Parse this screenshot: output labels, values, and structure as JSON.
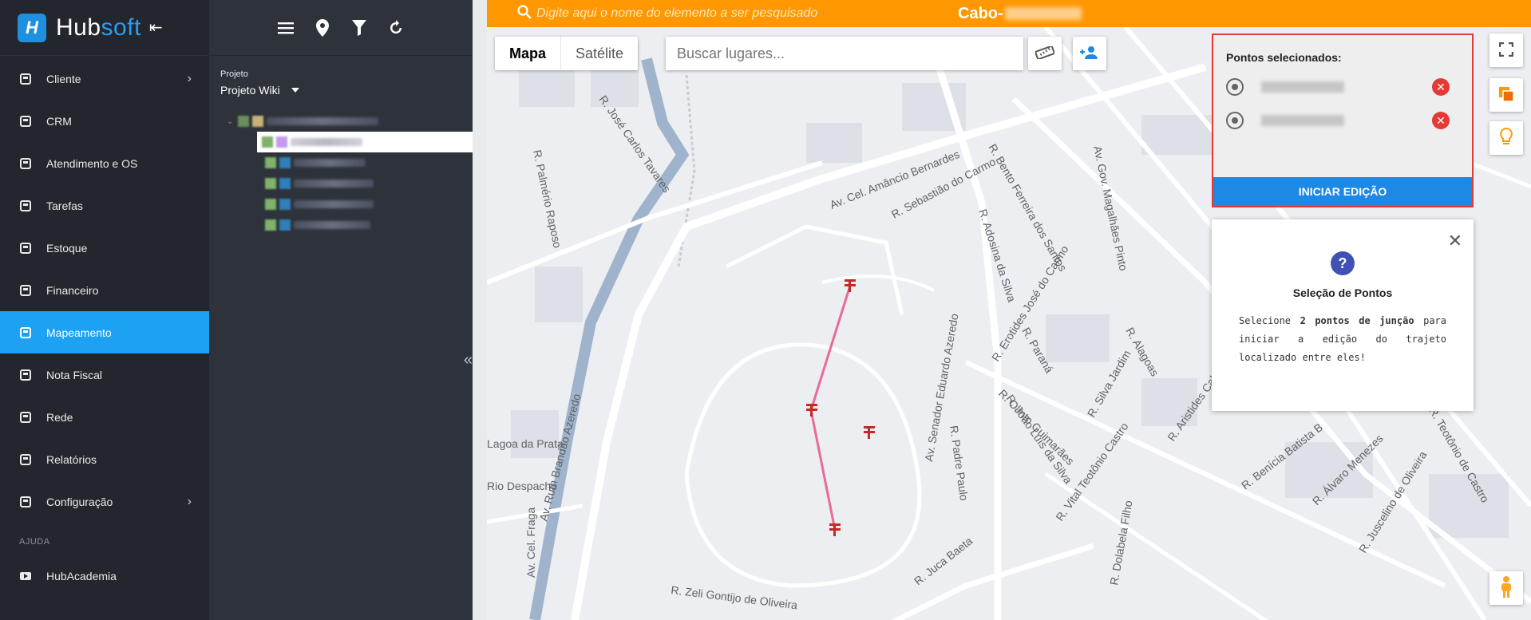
{
  "brand": {
    "name_a": "Hub",
    "name_b": "soft"
  },
  "nav": {
    "items": [
      {
        "label": "Cliente",
        "has_submenu": true
      },
      {
        "label": "CRM"
      },
      {
        "label": "Atendimento e OS"
      },
      {
        "label": "Tarefas"
      },
      {
        "label": "Estoque"
      },
      {
        "label": "Financeiro"
      },
      {
        "label": "Mapeamento",
        "active": true
      },
      {
        "label": "Nota Fiscal"
      },
      {
        "label": "Rede"
      },
      {
        "label": "Relatórios"
      },
      {
        "label": "Configuração",
        "has_submenu": true
      }
    ],
    "section_help": "AJUDA",
    "help_items": [
      {
        "label": "HubAcademia"
      }
    ]
  },
  "project_panel": {
    "label": "Projeto",
    "selected": "Projeto Wiki"
  },
  "topbar": {
    "search_placeholder": "Digite aqui o nome do elemento a ser pesquisado",
    "title_prefix": "Cabo-"
  },
  "map": {
    "type_map": "Mapa",
    "type_satellite": "Satélite",
    "search_placeholder": "Buscar lugares...",
    "streets": [
      "R. Palmério Raposo",
      "R. José Carlos Tavares",
      "Av. Cel. Amâncio Bernardes",
      "R. Sebastião do Carmo",
      "R. Bento Ferreira dos Santos",
      "Av. Gov. Magalhães Pinto",
      "R. Adosina da Silva",
      "R. Erotides José do Carmo",
      "Av. Senador Eduardo Azeredo",
      "R. Olinto Guimarães",
      "R. João Luís da Silva",
      "R. Silva Jardim",
      "Av. Ruth Brandão Azeredo",
      "R. Padre Paulo",
      "R. Zeli Gontijo de Oliveira",
      "R. Juca Baeta",
      "R. Vital Teotônio Castro",
      "R. Benícia Batista B",
      "R. Álvaro Menezes",
      "R. Juscelino de Oliveira",
      "R. Paraná",
      "R. Alagoas",
      "R. Aristides Cabral",
      "Av. Cel. Fraga",
      "Lagoa da Prata",
      "Rio Despacho",
      "R. Dolabela Filho",
      "R. Teotônio de Castro"
    ]
  },
  "selection": {
    "title": "Pontos selecionados:",
    "points": [
      {
        "id": "p1"
      },
      {
        "id": "p2"
      }
    ],
    "button": "INICIAR EDIÇÃO"
  },
  "help": {
    "title": "Seleção de Pontos",
    "text_1": "Selecione ",
    "text_bold": "2 pontos de junção",
    "text_2": " para iniciar a edição do trajeto localizado entre eles!"
  },
  "colors": {
    "accent_blue": "#1da1f2",
    "topbar_orange": "#ff9800",
    "sidebar_bg": "#23262d",
    "panel_bg": "#2e323a",
    "route_pink": "#e86a9a",
    "pole_red": "#c62828",
    "selection_border": "#e53935",
    "edit_button": "#1e88e5"
  }
}
